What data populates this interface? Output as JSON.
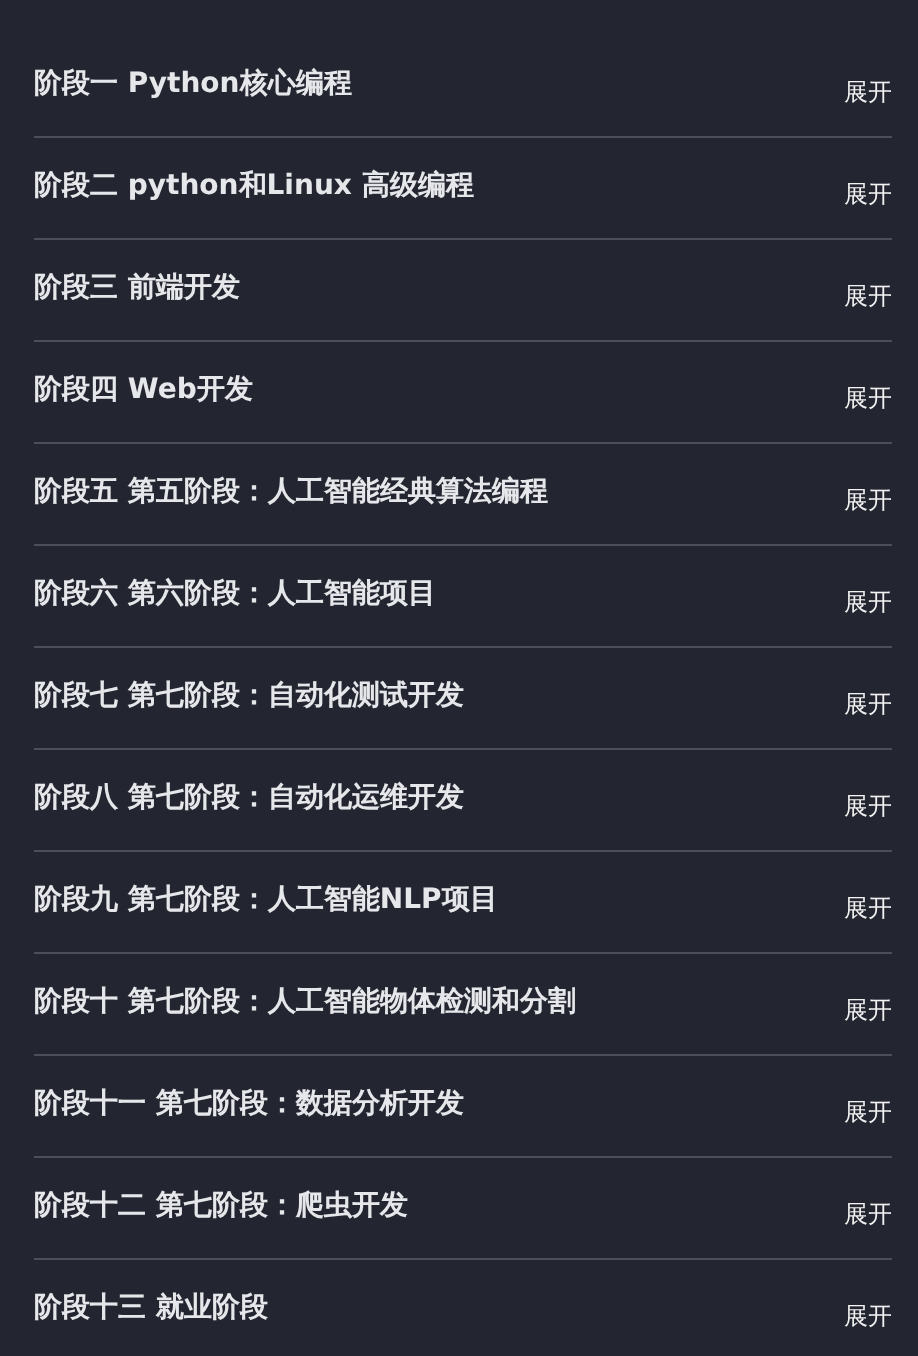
{
  "sections": [
    {
      "title": "阶段一 Python核心编程",
      "toggle": "展开"
    },
    {
      "title": "阶段二 python和Linux 高级编程",
      "toggle": "展开"
    },
    {
      "title": "阶段三 前端开发",
      "toggle": "展开"
    },
    {
      "title": "阶段四 Web开发",
      "toggle": "展开"
    },
    {
      "title": "阶段五 第五阶段：人工智能经典算法编程",
      "toggle": "展开"
    },
    {
      "title": "阶段六 第六阶段：人工智能项目",
      "toggle": "展开"
    },
    {
      "title": "阶段七 第七阶段：自动化测试开发",
      "toggle": "展开"
    },
    {
      "title": "阶段八 第七阶段：自动化运维开发",
      "toggle": "展开"
    },
    {
      "title": "阶段九 第七阶段：人工智能NLP项目",
      "toggle": "展开"
    },
    {
      "title": "阶段十 第七阶段：人工智能物体检测和分割",
      "toggle": "展开"
    },
    {
      "title": "阶段十一 第七阶段：数据分析开发",
      "toggle": "展开"
    },
    {
      "title": "阶段十二 第七阶段：爬虫开发",
      "toggle": "展开"
    },
    {
      "title": "阶段十三 就业阶段",
      "toggle": "展开"
    }
  ]
}
